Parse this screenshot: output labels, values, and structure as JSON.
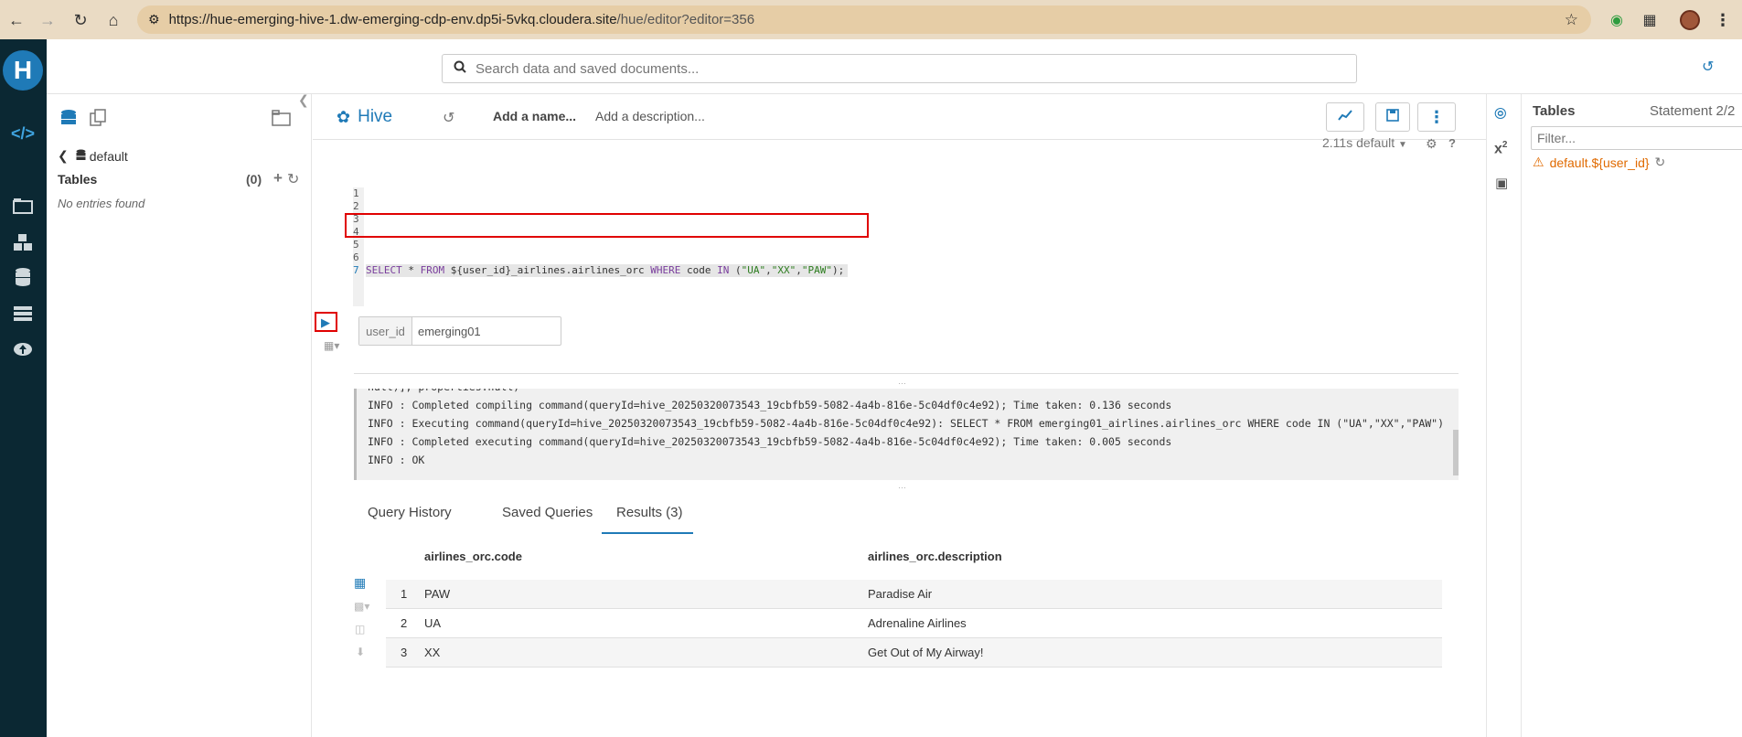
{
  "browser": {
    "url_host": "https://hue-emerging-hive-1.dw-emerging-cdp-env.dp5i-5vkq.cloudera.site",
    "url_path": "/hue/editor?editor=356"
  },
  "top_search": {
    "placeholder": "Search data and saved documents..."
  },
  "assist": {
    "database": "default",
    "tables_label": "Tables",
    "tables_count": "(0)",
    "empty_message": "No entries found"
  },
  "editor": {
    "engine": "Hive",
    "name_placeholder": "Add a name...",
    "description_placeholder": "Add a description...",
    "exec_info": "2.11s default",
    "line_numbers": [
      "1",
      "2",
      "3",
      "4",
      "5",
      "6",
      "7"
    ],
    "query": {
      "kw_select": "SELECT",
      "star": " * ",
      "kw_from": "FROM",
      "table": " ${user_id}_airlines.airlines_orc ",
      "kw_where": "WHERE",
      "col": " code ",
      "kw_in": "IN",
      "open": " (",
      "v1": "\"UA\"",
      "c1": ",",
      "v2": "\"XX\"",
      "c2": ",",
      "v3": "\"PAW\"",
      "close": ");"
    },
    "variable": {
      "name": "user_id",
      "value": "emerging01"
    }
  },
  "log": {
    "lines": [
      "null)], properties:null)",
      "INFO  : Completed compiling command(queryId=hive_20250320073543_19cbfb59-5082-4a4b-816e-5c04df0c4e92); Time taken: 0.136 seconds",
      "INFO  : Executing command(queryId=hive_20250320073543_19cbfb59-5082-4a4b-816e-5c04df0c4e92): SELECT * FROM emerging01_airlines.airlines_orc WHERE code IN (\"UA\",\"XX\",\"PAW\")",
      "INFO  : Completed executing command(queryId=hive_20250320073543_19cbfb59-5082-4a4b-816e-5c04df0c4e92); Time taken: 0.005 seconds",
      "INFO  : OK"
    ]
  },
  "result_tabs": [
    "Query History",
    "Saved Queries",
    "Results (3)"
  ],
  "results": {
    "columns": [
      "airlines_orc.code",
      "airlines_orc.description"
    ],
    "rows": [
      {
        "n": "1",
        "code": "PAW",
        "description": "Paradise Air"
      },
      {
        "n": "2",
        "code": "UA",
        "description": "Adrenaline Airlines"
      },
      {
        "n": "3",
        "code": "XX",
        "description": "Get Out of My Airway!"
      }
    ]
  },
  "right_panel": {
    "tables_label": "Tables",
    "statement": "Statement 2/2",
    "filter_placeholder": "Filter...",
    "warning_item": "default.${user_id}"
  },
  "colors": {
    "accent": "#1f7ab7",
    "rail": "#0b2833",
    "keyword": "#7a3e9d",
    "string": "#2d7d1f",
    "warning": "#e06a00",
    "highlight": "#e00000"
  }
}
